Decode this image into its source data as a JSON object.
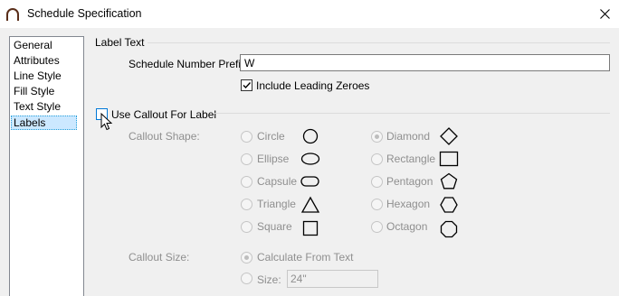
{
  "window": {
    "title": "Schedule Specification",
    "app_icon": "arch-icon",
    "close_icon": "close-icon"
  },
  "nav": {
    "items": [
      {
        "label": "General"
      },
      {
        "label": "Attributes"
      },
      {
        "label": "Line Style"
      },
      {
        "label": "Fill Style"
      },
      {
        "label": "Text Style"
      },
      {
        "label": "Labels",
        "selected": true
      }
    ]
  },
  "label_text": {
    "group_title": "Label Text",
    "prefix_label": "Schedule Number Prefix:",
    "prefix_value": "W",
    "leading_zeroes_label": "Include Leading Zeroes",
    "leading_zeroes_checked": true
  },
  "callout": {
    "use_callout_label": "Use Callout For Label",
    "use_callout_checked": false,
    "shape_label": "Callout Shape:",
    "shapes_left": [
      {
        "label": "Circle",
        "icon": "circle-icon",
        "selected": false
      },
      {
        "label": "Ellipse",
        "icon": "ellipse-icon",
        "selected": false
      },
      {
        "label": "Capsule",
        "icon": "capsule-icon",
        "selected": false
      },
      {
        "label": "Triangle",
        "icon": "triangle-icon",
        "selected": false
      },
      {
        "label": "Square",
        "icon": "square-icon",
        "selected": false
      }
    ],
    "shapes_right": [
      {
        "label": "Diamond",
        "icon": "diamond-icon",
        "selected": true
      },
      {
        "label": "Rectangle",
        "icon": "rectangle-icon",
        "selected": false
      },
      {
        "label": "Pentagon",
        "icon": "pentagon-icon",
        "selected": false
      },
      {
        "label": "Hexagon",
        "icon": "hexagon-icon",
        "selected": false
      },
      {
        "label": "Octagon",
        "icon": "octagon-icon",
        "selected": false
      }
    ],
    "size_label": "Callout Size:",
    "size_options": [
      {
        "label": "Calculate From Text",
        "selected": true
      },
      {
        "label": "Size:",
        "selected": false
      }
    ],
    "size_value": "24\""
  },
  "colors": {
    "selection_bg": "#cce8ff",
    "selection_border": "#26a0da",
    "dialog_bg": "#f0f0f0",
    "disabled_text": "#8f8f8f",
    "focus_border": "#0078d7"
  }
}
